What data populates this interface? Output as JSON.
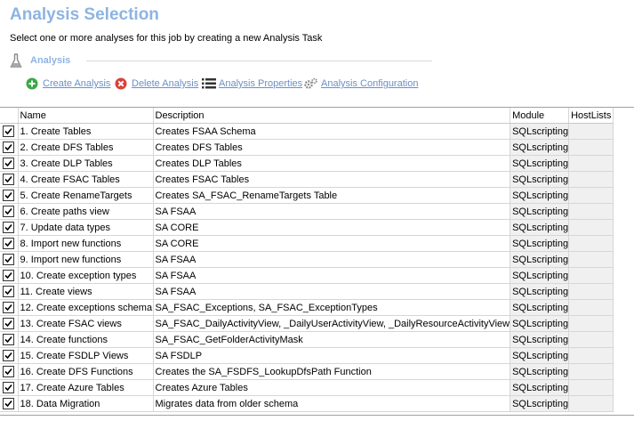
{
  "header": {
    "title": "Analysis Selection",
    "subtitle": "Select one or more analyses for this job by creating a new Analysis Task"
  },
  "section": {
    "label": "Analysis"
  },
  "toolbar": {
    "create": "Create Analysis",
    "delete": "Delete Analysis",
    "properties": "Analysis Properties",
    "configuration": "Analysis Configuration"
  },
  "table": {
    "columns": [
      "Name",
      "Description",
      "Module",
      "HostLists"
    ],
    "rows": [
      {
        "checked": true,
        "name": "1. Create Tables",
        "description": "Creates FSAA Schema",
        "module": "SQLscripting",
        "hostlists": ""
      },
      {
        "checked": true,
        "name": "2. Create DFS Tables",
        "description": "Creates DFS Tables",
        "module": "SQLscripting",
        "hostlists": ""
      },
      {
        "checked": true,
        "name": "3. Create DLP Tables",
        "description": "Creates DLP Tables",
        "module": "SQLscripting",
        "hostlists": ""
      },
      {
        "checked": true,
        "name": "4. Create FSAC Tables",
        "description": "Creates FSAC Tables",
        "module": "SQLscripting",
        "hostlists": ""
      },
      {
        "checked": true,
        "name": "5. Create RenameTargets",
        "description": "Creates SA_FSAC_RenameTargets Table",
        "module": "SQLscripting",
        "hostlists": ""
      },
      {
        "checked": true,
        "name": "6. Create paths view",
        "description": "SA FSAA",
        "module": "SQLscripting",
        "hostlists": ""
      },
      {
        "checked": true,
        "name": "7. Update data types",
        "description": "SA CORE",
        "module": "SQLscripting",
        "hostlists": ""
      },
      {
        "checked": true,
        "name": "8. Import new functions",
        "description": "SA CORE",
        "module": "SQLscripting",
        "hostlists": ""
      },
      {
        "checked": true,
        "name": "9. Import new functions",
        "description": "SA FSAA",
        "module": "SQLscripting",
        "hostlists": ""
      },
      {
        "checked": true,
        "name": "10. Create exception types",
        "description": "SA FSAA",
        "module": "SQLscripting",
        "hostlists": ""
      },
      {
        "checked": true,
        "name": "11. Create views",
        "description": "SA FSAA",
        "module": "SQLscripting",
        "hostlists": ""
      },
      {
        "checked": true,
        "name": "12. Create exceptions schema",
        "description": "SA_FSAC_Exceptions, SA_FSAC_ExceptionTypes",
        "module": "SQLscripting",
        "hostlists": ""
      },
      {
        "checked": true,
        "name": "13. Create FSAC views",
        "description": "SA_FSAC_DailyActivityView, _DailyUserActivityView, _DailyResourceActivityView",
        "module": "SQLscripting",
        "hostlists": ""
      },
      {
        "checked": true,
        "name": "14. Create functions",
        "description": "SA_FSAC_GetFolderActivityMask",
        "module": "SQLscripting",
        "hostlists": ""
      },
      {
        "checked": true,
        "name": "15. Create FSDLP Views",
        "description": "SA FSDLP",
        "module": "SQLscripting",
        "hostlists": ""
      },
      {
        "checked": true,
        "name": "16. Create DFS  Functions",
        "description": "Creates the SA_FSDFS_LookupDfsPath Function",
        "module": "SQLscripting",
        "hostlists": ""
      },
      {
        "checked": true,
        "name": "17. Create Azure Tables",
        "description": "Creates Azure Tables",
        "module": "SQLscripting",
        "hostlists": ""
      },
      {
        "checked": true,
        "name": "18. Data Migration",
        "description": "Migrates data from older schema",
        "module": "SQLscripting",
        "hostlists": ""
      }
    ]
  },
  "icons": {
    "section": "flask-icon",
    "create": "plus-circle-icon",
    "delete": "x-circle-icon",
    "properties": "list-icon",
    "configuration": "gears-icon"
  },
  "colors": {
    "title": "#8db4e2",
    "link": "#6b8fc7",
    "create_icon": "#3aa845",
    "delete_icon": "#d9413a"
  }
}
